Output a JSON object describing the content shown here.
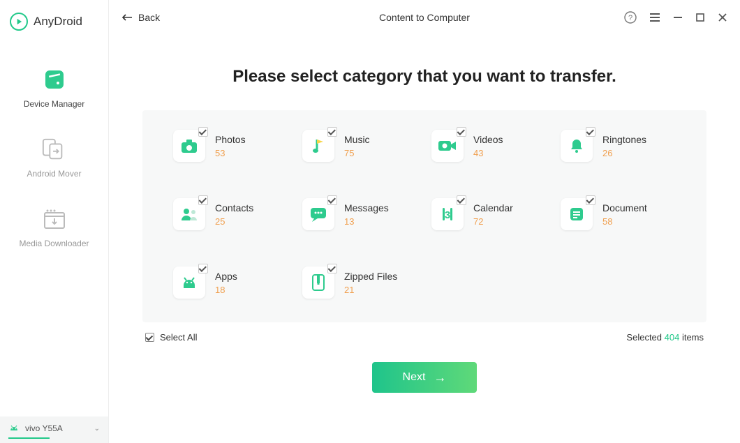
{
  "app_name": "AnyDroid",
  "titlebar": {
    "back": "Back",
    "title": "Content to Computer"
  },
  "sidebar": {
    "items": [
      {
        "label": "Device Manager"
      },
      {
        "label": "Android Mover"
      },
      {
        "label": "Media Downloader"
      }
    ],
    "device": "vivo Y55A"
  },
  "heading": "Please select category that you want to transfer.",
  "categories": [
    {
      "key": "photos",
      "label": "Photos",
      "count": "53"
    },
    {
      "key": "music",
      "label": "Music",
      "count": "75"
    },
    {
      "key": "videos",
      "label": "Videos",
      "count": "43"
    },
    {
      "key": "ringtones",
      "label": "Ringtones",
      "count": "26"
    },
    {
      "key": "contacts",
      "label": "Contacts",
      "count": "25"
    },
    {
      "key": "messages",
      "label": "Messages",
      "count": "13"
    },
    {
      "key": "calendar",
      "label": "Calendar",
      "count": "72"
    },
    {
      "key": "document",
      "label": "Document",
      "count": "58"
    },
    {
      "key": "apps",
      "label": "Apps",
      "count": "18"
    },
    {
      "key": "zipped",
      "label": "Zipped Files",
      "count": "21"
    }
  ],
  "footer": {
    "select_all": "Select All",
    "selected_prefix": "Selected ",
    "selected_count": "404",
    "selected_suffix": " items"
  },
  "next_label": "Next"
}
